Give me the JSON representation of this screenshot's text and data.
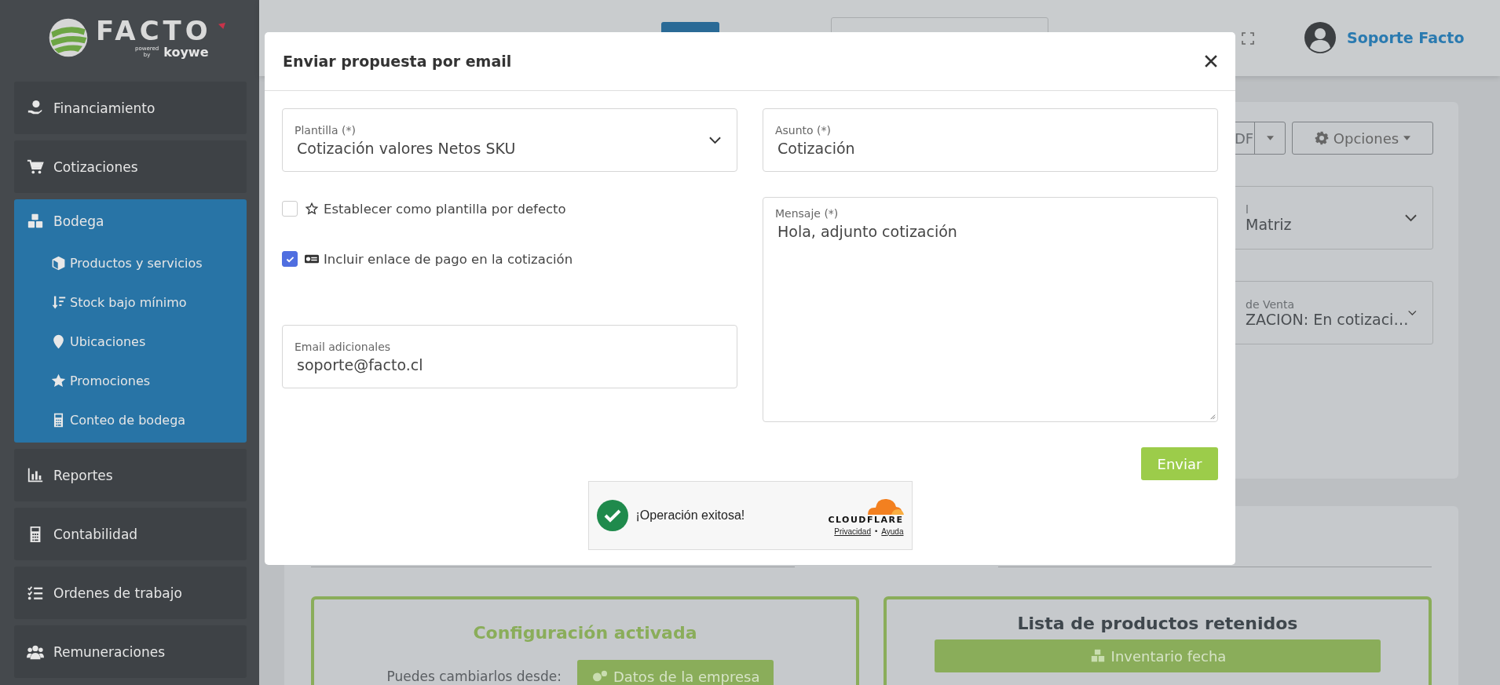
{
  "sidebar": {
    "logo": {
      "name": "FACTO",
      "powered": "powered",
      "by": "by",
      "brand": "koywe"
    },
    "items": [
      {
        "label": "Financiamiento",
        "selected": false
      },
      {
        "label": "Cotizaciones",
        "selected": false
      },
      {
        "label": "Bodega",
        "selected": true,
        "expanded": true,
        "children": [
          {
            "label": "Productos y servicios"
          },
          {
            "label": "Stock bajo mínimo"
          },
          {
            "label": "Ubicaciones"
          },
          {
            "label": "Promociones"
          },
          {
            "label": "Conteo de bodega"
          }
        ]
      },
      {
        "label": "Reportes",
        "selected": false
      },
      {
        "label": "Contabilidad",
        "selected": false
      },
      {
        "label": "Ordenes de trabajo",
        "selected": false
      },
      {
        "label": "Remuneraciones",
        "selected": false
      }
    ]
  },
  "header": {
    "user": "Soporte Facto"
  },
  "document_card": {
    "pdf_button": "DF",
    "options_button": "Opciones",
    "fields": [
      {
        "label": "l",
        "value": "Matriz"
      },
      {
        "label": "de Venta",
        "value": "ZACION: En cotizaci…"
      }
    ]
  },
  "config_card": {
    "title": "Configuración activada",
    "text": "Puedes cambiarlos desde:",
    "button": "Datos de la empresa"
  },
  "retained_card": {
    "title": "Lista de productos retenidos",
    "button": "Inventario fecha"
  },
  "modal": {
    "title": "Enviar propuesta por email",
    "template": {
      "label": "Plantilla (*)",
      "value": "Cotización valores Netos SKU"
    },
    "subject": {
      "label": "Asunto (*)",
      "value": "Cotización"
    },
    "options": [
      {
        "label": "Establecer como plantilla por defecto",
        "checked": false
      },
      {
        "label": "Incluir enlace de pago en la cotización",
        "checked": true
      }
    ],
    "email": {
      "label": "Email adicionales",
      "value": "soporte@facto.cl"
    },
    "message": {
      "label": "Mensaje (*)",
      "value": "Hola, adjunto cotización"
    },
    "send_button": "Enviar",
    "captcha": {
      "status": "¡Operación exitosa!",
      "brand": "CLOUDFLARE",
      "links": [
        "Privacidad",
        "Ayuda"
      ],
      "separator": "•"
    }
  }
}
